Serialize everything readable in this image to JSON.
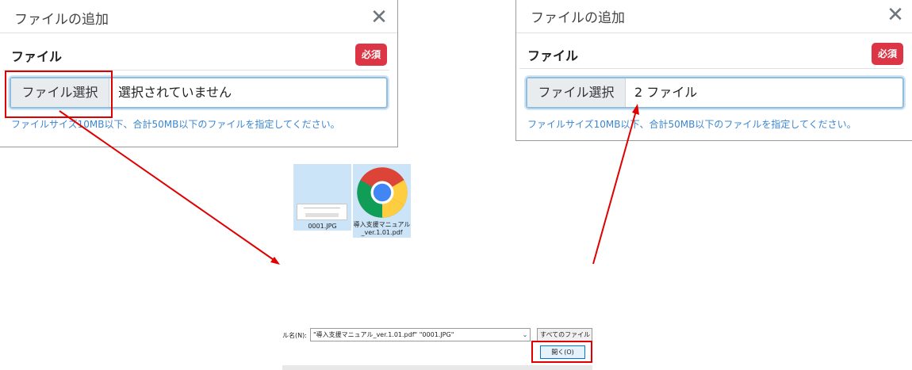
{
  "left_modal": {
    "title": "ファイルの追加",
    "close": "✕",
    "field_label": "ファイル",
    "required": "必須",
    "choose_button": "ファイル選択",
    "status": "選択されていません",
    "help": "ファイルサイズ10MB以下、合計50MB以下のファイルを指定してください。"
  },
  "right_modal": {
    "title": "ファイルの追加",
    "close": "✕",
    "field_label": "ファイル",
    "required": "必須",
    "choose_button": "ファイル選択",
    "status": "2 ファイル",
    "help": "ファイルサイズ10MB以下、合計50MB以下のファイルを指定してください。"
  },
  "file_dialog": {
    "files": [
      {
        "name": "0001.JPG",
        "icon": "image-thumbnail"
      },
      {
        "name": "導入支援マニュアル_ver.1.01.pdf",
        "icon": "chrome-icon"
      }
    ],
    "filename_label": "ル名(N):",
    "filename_value": "\"導入支援マニュアル_ver.1.01.pdf\" \"0001.JPG\"",
    "filetype_value": "すべてのファイル (*.*)",
    "open_button": "開く(O)"
  },
  "colors": {
    "required_badge": "#dc3545",
    "help_text": "#3a86d0",
    "annotation_red": "#e00000",
    "selection_blue": "#cce4f7"
  }
}
